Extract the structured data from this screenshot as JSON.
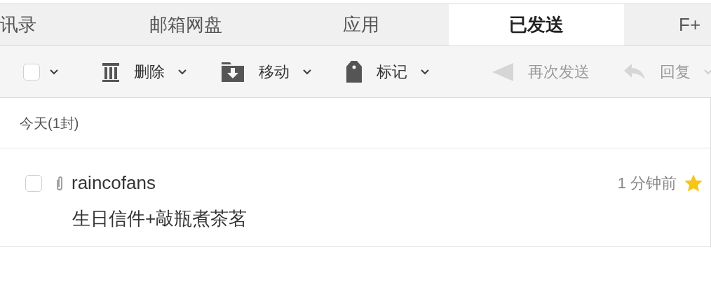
{
  "tabs": [
    {
      "label": "讯录",
      "selected": false
    },
    {
      "label": "邮箱网盘",
      "selected": false
    },
    {
      "label": "应用",
      "selected": false
    },
    {
      "label": "已发送",
      "selected": true
    },
    {
      "label": "F+",
      "selected": false
    }
  ],
  "toolbar": {
    "select_all": {
      "checked": false
    },
    "actions": [
      {
        "kind": "delete",
        "label": "删除",
        "disabled": false,
        "dropdown": true
      },
      {
        "kind": "move",
        "label": "移动",
        "disabled": false,
        "dropdown": true
      },
      {
        "kind": "mark",
        "label": "标记",
        "disabled": false,
        "dropdown": true
      },
      {
        "kind": "resend",
        "label": "再次发送",
        "disabled": true,
        "dropdown": false
      },
      {
        "kind": "reply",
        "label": "回复",
        "disabled": true,
        "dropdown": true
      }
    ]
  },
  "group": {
    "title": "今天(1封)"
  },
  "messages": [
    {
      "sender": "raincofans",
      "subject": "生日信件+敲瓶煮茶茗",
      "time": "1 分钟前",
      "checked": false,
      "attachment": true,
      "starred": true
    }
  ]
}
